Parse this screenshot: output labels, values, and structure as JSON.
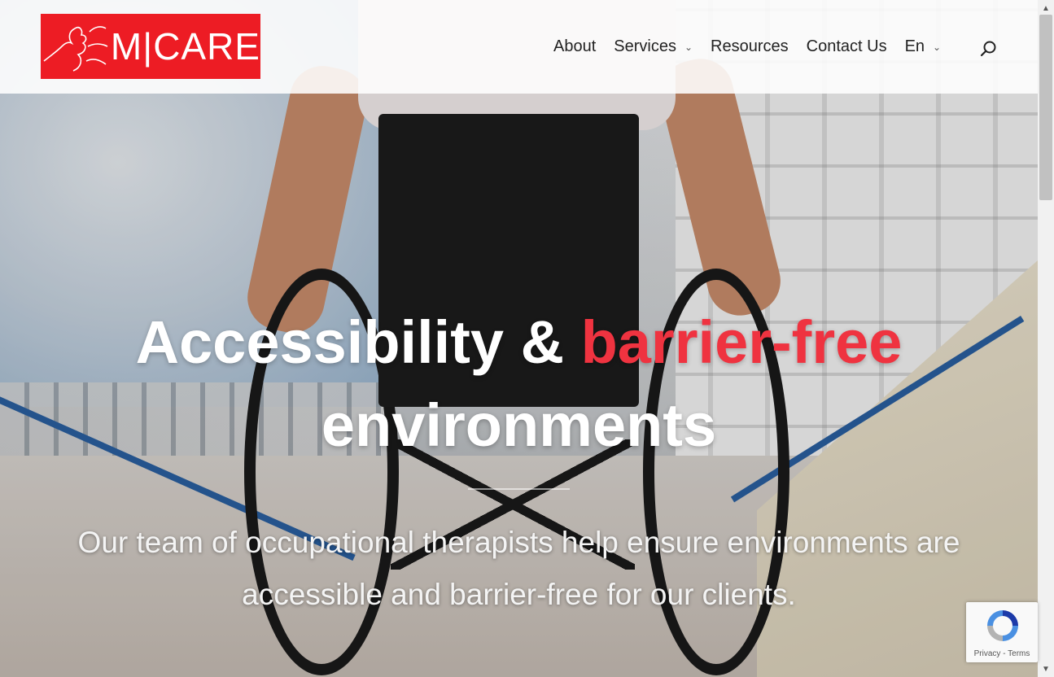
{
  "logo": {
    "text": "M|CARE",
    "brand_color": "#ed1c24"
  },
  "nav": {
    "items": [
      {
        "label": "About",
        "has_dropdown": false
      },
      {
        "label": "Services",
        "has_dropdown": true
      },
      {
        "label": "Resources",
        "has_dropdown": false
      },
      {
        "label": "Contact Us",
        "has_dropdown": false
      },
      {
        "label": "En",
        "has_dropdown": true
      }
    ],
    "search_icon": "search-icon",
    "dropdown_icon": "chevron-down-icon"
  },
  "hero": {
    "headline_part1": "Accessibility & ",
    "headline_accent": "barrier-free",
    "headline_part2": "environments",
    "subtext": "Our team of occupational therapists help ensure environments are accessible and barrier-free for our clients.",
    "accent_color": "#ef3340",
    "background_image": "wheelchair user on ramp"
  },
  "recaptcha": {
    "privacy": "Privacy",
    "separator": " - ",
    "terms": "Terms"
  }
}
